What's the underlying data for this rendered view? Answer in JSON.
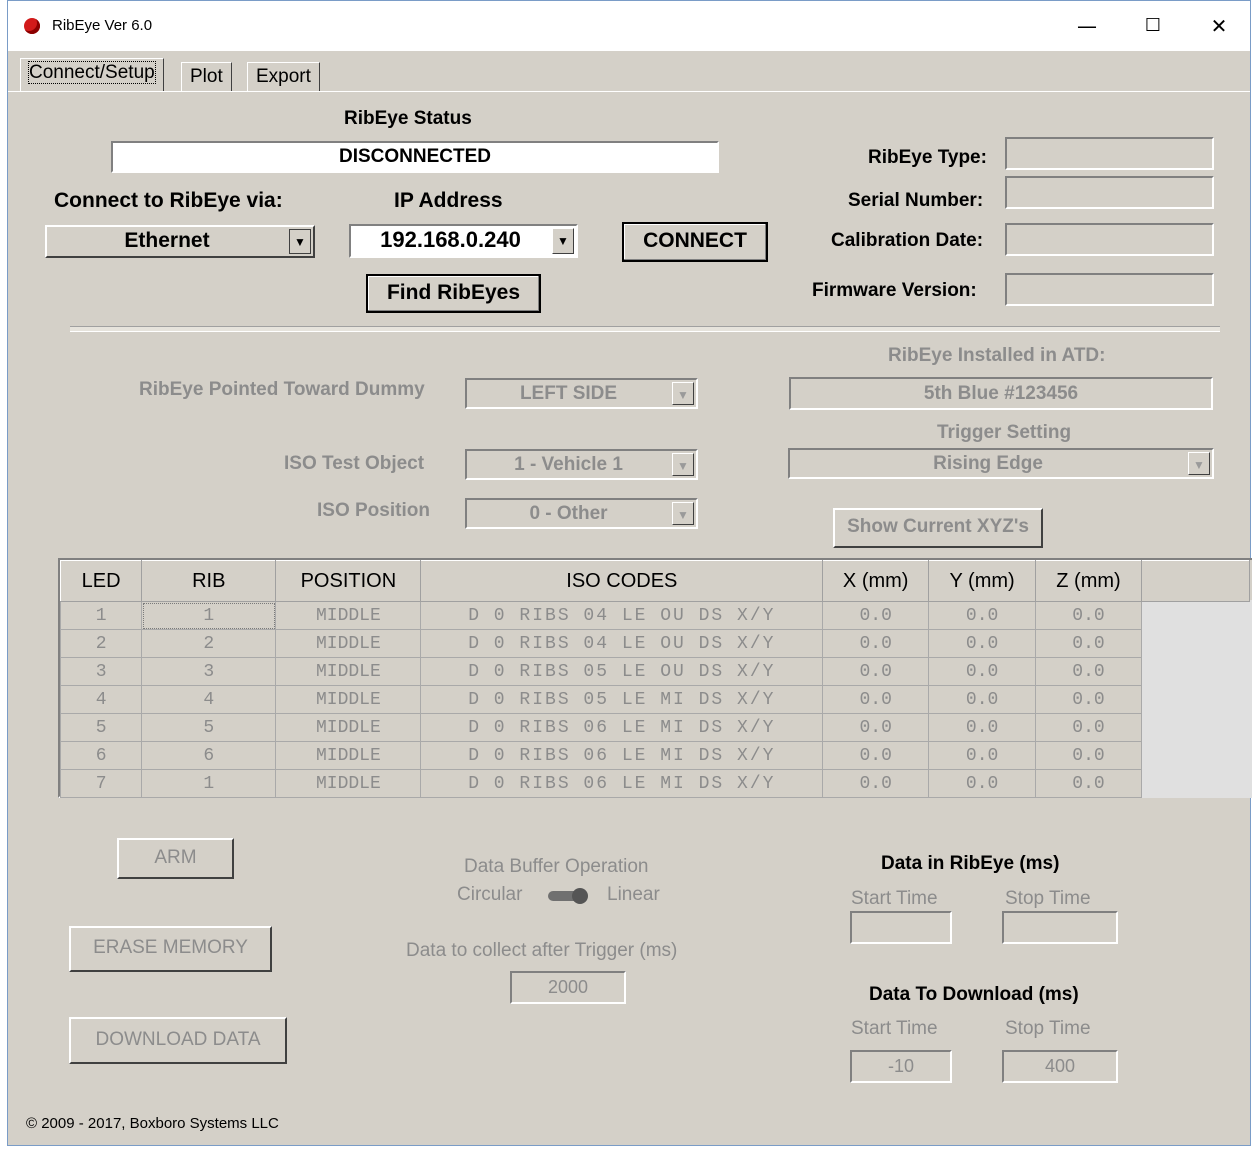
{
  "window": {
    "title": "RibEye Ver 6.0",
    "minimize": "—",
    "maximize": "☐",
    "close": "✕"
  },
  "tabs": [
    {
      "label": "Connect/Setup"
    },
    {
      "label": "Plot"
    },
    {
      "label": "Export"
    }
  ],
  "status": {
    "heading": "RibEye Status",
    "value": "DISCONNECTED"
  },
  "connect": {
    "via_label": "Connect to RibEye via:",
    "via_value": "Ethernet",
    "ip_label": "IP Address",
    "ip_value": "192.168.0.240",
    "connect_button": "CONNECT",
    "find_button": "Find RibEyes"
  },
  "info": {
    "type_label": "RibEye Type:",
    "serial_label": "Serial Number:",
    "calibration_label": "Calibration Date:",
    "firmware_label": "Firmware Version:"
  },
  "setup": {
    "installed_label": "RibEye Installed in ATD:",
    "installed_value": "5th Blue #123456",
    "pointed_label": "RibEye Pointed Toward Dummy",
    "pointed_value": "LEFT SIDE",
    "iso_object_label": "ISO Test Object",
    "iso_object_value": "1 - Vehicle 1",
    "iso_position_label": "ISO Position",
    "iso_position_value": "0 - Other",
    "trigger_label": "Trigger Setting",
    "trigger_value": "Rising  Edge",
    "show_xyz_button": "Show Current XYZ's"
  },
  "table": {
    "headers": [
      "LED",
      "RIB",
      "POSITION",
      "ISO CODES",
      "X (mm)",
      "Y (mm)",
      "Z (mm)"
    ],
    "rows": [
      [
        "1",
        "1",
        "MIDDLE",
        "D 0 RIBS 04 LE OU DS X/Y",
        "0.0",
        "0.0",
        "0.0"
      ],
      [
        "2",
        "2",
        "MIDDLE",
        "D 0 RIBS 04 LE OU DS X/Y",
        "0.0",
        "0.0",
        "0.0"
      ],
      [
        "3",
        "3",
        "MIDDLE",
        "D 0 RIBS 05 LE OU DS X/Y",
        "0.0",
        "0.0",
        "0.0"
      ],
      [
        "4",
        "4",
        "MIDDLE",
        "D 0 RIBS 05 LE MI DS X/Y",
        "0.0",
        "0.0",
        "0.0"
      ],
      [
        "5",
        "5",
        "MIDDLE",
        "D 0 RIBS 06 LE MI DS X/Y",
        "0.0",
        "0.0",
        "0.0"
      ],
      [
        "6",
        "6",
        "MIDDLE",
        "D 0 RIBS 06 LE MI DS X/Y",
        "0.0",
        "0.0",
        "0.0"
      ],
      [
        "7",
        "1",
        "MIDDLE",
        "D 0 RIBS 06 LE MI DS X/Y",
        "0.0",
        "0.0",
        "0.0"
      ]
    ]
  },
  "actions": {
    "arm": "ARM",
    "erase": "ERASE MEMORY",
    "download": "DOWNLOAD DATA"
  },
  "buffer": {
    "heading": "Data Buffer Operation",
    "circular": "Circular",
    "linear": "Linear",
    "after_trigger_label": "Data to collect after Trigger (ms)",
    "after_trigger_value": "2000"
  },
  "data_in_ribeye": {
    "heading": "Data in RibEye (ms)",
    "start_label": "Start Time",
    "stop_label": "Stop Time",
    "start_value": "",
    "stop_value": ""
  },
  "data_download": {
    "heading": "Data To Download (ms)",
    "start_label": "Start Time",
    "stop_label": "Stop Time",
    "start_value": "-10",
    "stop_value": "400"
  },
  "footer": {
    "copyright": "© 2009 - 2017, Boxboro Systems LLC"
  }
}
